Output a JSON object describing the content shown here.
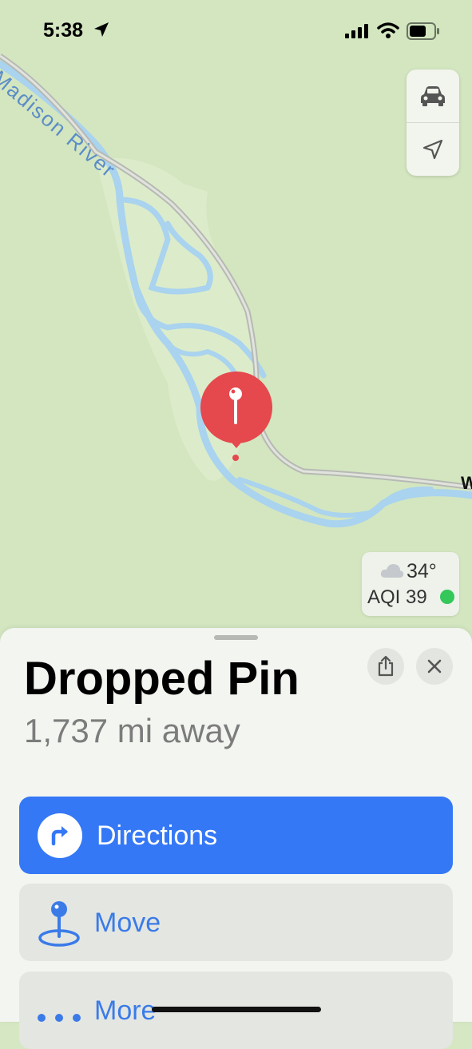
{
  "status_bar": {
    "time": "5:38"
  },
  "map": {
    "river_label": "Madison River",
    "road_label_partial": "W"
  },
  "map_controls": {
    "items": [
      "car-icon",
      "location-arrow-icon"
    ]
  },
  "weather": {
    "temperature": "34°",
    "aqi": "AQI 39",
    "aqi_color": "#34c759"
  },
  "place": {
    "title": "Dropped Pin",
    "distance": "1,737 mi away"
  },
  "actions": {
    "directions": "Directions",
    "move": "Move",
    "more": "More"
  },
  "colors": {
    "accent": "#3478f6",
    "pin": "#e5484d",
    "map_land": "#d3e6c0",
    "water": "#a9d3ee"
  }
}
